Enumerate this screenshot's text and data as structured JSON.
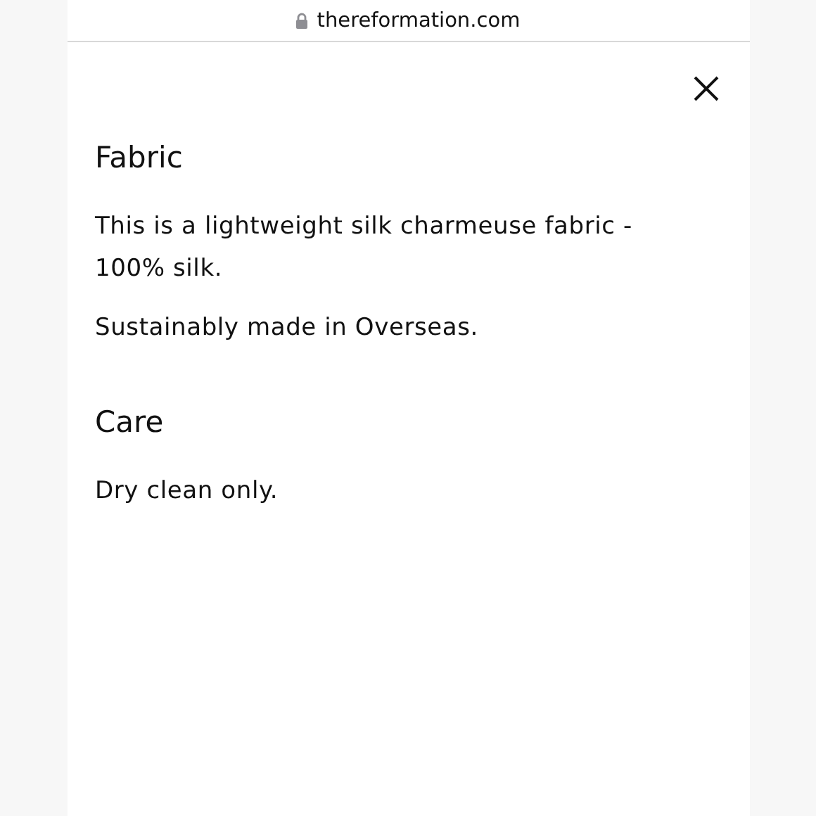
{
  "browser": {
    "url": "thereformation.com"
  },
  "sections": [
    {
      "heading": "Fabric",
      "paragraphs": [
        "This is a lightweight silk charmeuse fabric - 100% silk.",
        "Sustainably made in Overseas."
      ]
    },
    {
      "heading": "Care",
      "paragraphs": [
        "Dry clean only."
      ]
    }
  ]
}
